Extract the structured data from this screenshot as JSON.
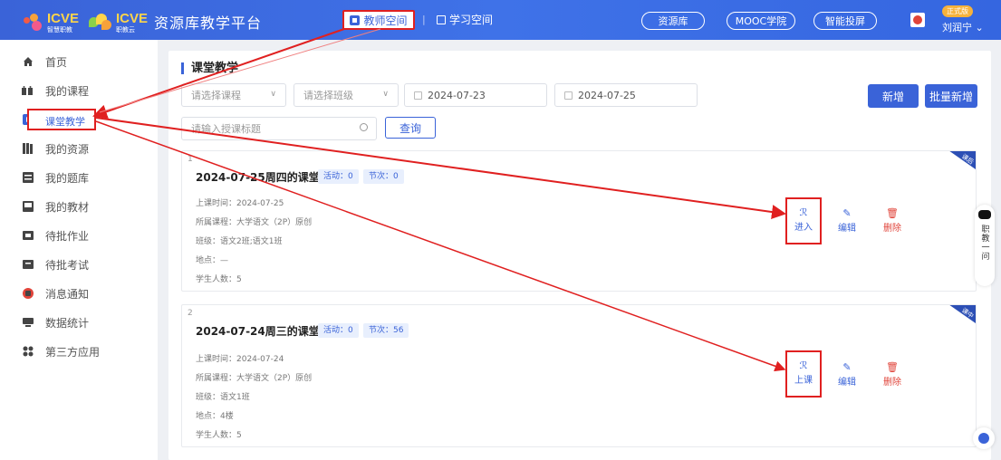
{
  "header": {
    "logo1_text": "ICVE",
    "logo1_sub": "智慧职教",
    "logo2_text": "ICVE",
    "logo2_sub": "职教云",
    "site_title": "资源库教学平台",
    "nav_active": "教师空间",
    "nav_sep": "|",
    "nav_study": "学习空间",
    "pills": [
      "资源库",
      "MOOC学院",
      "智能投屏"
    ],
    "badge": "正式版",
    "username": "刘润宁 ⌄"
  },
  "sidebar": {
    "items": [
      {
        "label": "首页",
        "icon": "home-icon"
      },
      {
        "label": "我的课程",
        "icon": "course-icon"
      },
      {
        "label": "课堂教学",
        "icon": "classroom-icon",
        "active": true
      },
      {
        "label": "我的资源",
        "icon": "resource-icon"
      },
      {
        "label": "我的题库",
        "icon": "question-bank-icon"
      },
      {
        "label": "我的教材",
        "icon": "textbook-icon"
      },
      {
        "label": "待批作业",
        "icon": "homework-icon"
      },
      {
        "label": "待批考试",
        "icon": "exam-icon"
      },
      {
        "label": "消息通知",
        "icon": "message-icon"
      },
      {
        "label": "数据统计",
        "icon": "stats-icon"
      },
      {
        "label": "第三方应用",
        "icon": "apps-icon"
      }
    ],
    "active_color": "#3a63d8"
  },
  "main": {
    "title": "课堂教学",
    "filters": {
      "course_placeholder": "请选择课程",
      "class_placeholder": "请选择班级",
      "date_start": "2024-07-23",
      "date_end": "2024-07-25",
      "search_placeholder": "请输入授课标题",
      "query_label": "查询",
      "add_label": "新增",
      "batch_add_label": "批量新增"
    },
    "cards": [
      {
        "index": "1",
        "title": "2024-07-25周四的课堂教学",
        "activity": "活动：0",
        "section": "节次：0",
        "time": "上课时间：2024-07-25",
        "course": "所属课程：大学语文（2P）原创",
        "class": "班级：语文2班;语文1班",
        "location": "地点：—",
        "students": "学生人数：5",
        "ribbon": "课后",
        "primary_action": "进入",
        "edit": "编辑",
        "delete": "删除"
      },
      {
        "index": "2",
        "title": "2024-07-24周三的课堂教学",
        "activity": "活动：0",
        "section": "节次：56",
        "time": "上课时间：2024-07-24",
        "course": "所属课程：大学语文（2P）原创",
        "class": "班级：语文1班",
        "location": "地点：4楼",
        "students": "学生人数：5",
        "ribbon": "课中",
        "primary_action": "上课",
        "edit": "编辑",
        "delete": "删除"
      }
    ]
  },
  "float": {
    "robot_label": "职教一问"
  },
  "colors": {
    "brand": "#3a63d8",
    "annotation": "#e02020",
    "delete": "#e0443a"
  }
}
